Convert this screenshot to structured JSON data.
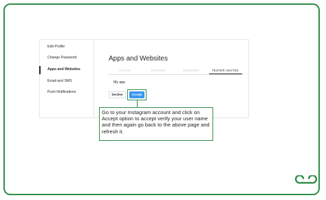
{
  "sidebar": {
    "items": [
      {
        "label": "Edit Profile"
      },
      {
        "label": "Change Password"
      },
      {
        "label": "Apps and Websites"
      },
      {
        "label": "Email and SMS"
      },
      {
        "label": "Push Notifications"
      }
    ]
  },
  "main": {
    "title": "Apps and Websites",
    "tabs": [
      {
        "label": "ACTIVE"
      },
      {
        "label": "EXPIRED"
      },
      {
        "label": "REMOVED"
      },
      {
        "label": "TESTER INVITES"
      }
    ],
    "app_name": "My app",
    "decline_label": "Decline",
    "accept_label": "Accept"
  },
  "callout": {
    "text": "Go to your Instagram account and click on Accept option to accept verify your user name and then again go back to the above page and refresh it."
  },
  "colors": {
    "frame_border": "#2f8d46",
    "accept_button": "#3897f0"
  },
  "icons": {
    "logo": "geeksforgeeks-logo"
  }
}
